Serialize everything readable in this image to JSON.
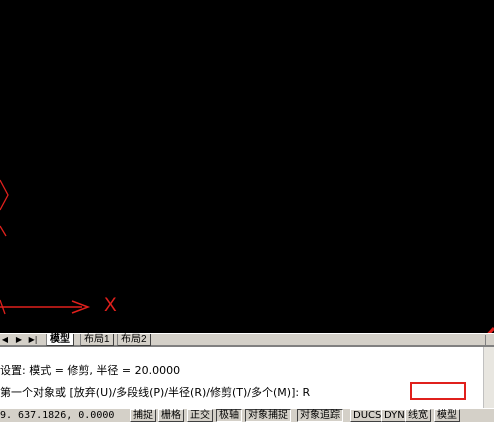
{
  "canvas": {
    "ucs_axis_label": "X"
  },
  "annotation_color": "#e0201c",
  "layout_tabs": {
    "nav": [
      "◀",
      "▶",
      "▶|"
    ],
    "tabs": [
      "模型",
      "布局1",
      "布局2"
    ],
    "active": "模型"
  },
  "command": {
    "line1": "设置: 模式 = 修剪, 半径 = 20.0000",
    "line2": "第一个对象或 [放弃(U)/多段线(P)/半径(R)/修剪(T)/多个(M)]: R"
  },
  "status": {
    "coordinates": "9. 637.1826, 0.0000",
    "buttons": [
      "捕捉",
      "栅格",
      "正交",
      "极轴",
      "对象捕捉",
      "对象追踪",
      "DUCS",
      "DYN",
      "线宽",
      "模型"
    ]
  }
}
